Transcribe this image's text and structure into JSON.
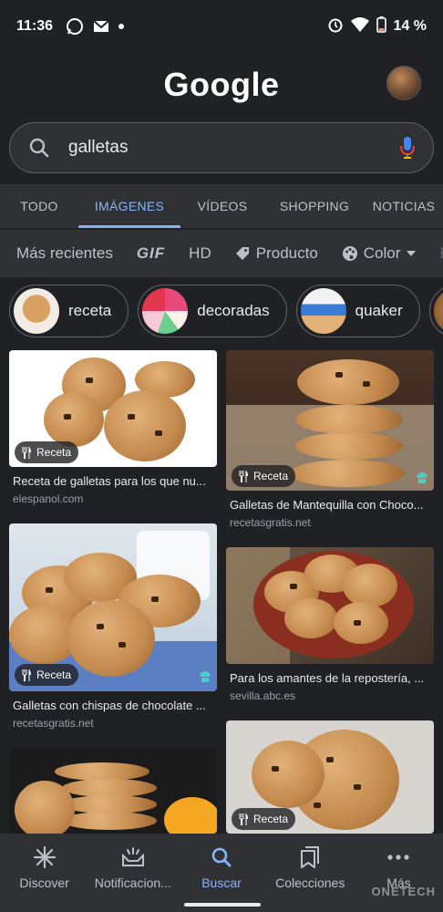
{
  "status_bar": {
    "time": "11:36",
    "battery": "14 %",
    "icons": [
      "whatsapp-icon",
      "gmail-icon",
      "dot-icon",
      "alarm-icon",
      "wifi-icon",
      "battery-icon"
    ]
  },
  "header": {
    "logo": "Google"
  },
  "search": {
    "query": "galletas"
  },
  "tabs": [
    {
      "label": "TODO",
      "active": false
    },
    {
      "label": "IMÁGENES",
      "active": true
    },
    {
      "label": "VÍDEOS",
      "active": false
    },
    {
      "label": "SHOPPING",
      "active": false
    },
    {
      "label": "NOTICIAS",
      "active": false
    }
  ],
  "filters": [
    "Más recientes",
    "GIF",
    "HD",
    "Producto",
    "Color",
    "E"
  ],
  "chips": [
    {
      "label": "receta"
    },
    {
      "label": "decoradas"
    },
    {
      "label": "quaker"
    }
  ],
  "results": [
    {
      "caption": "Receta de galletas para los que nu...",
      "source": "elespanol.com",
      "badge": "Receta"
    },
    {
      "caption": "Galletas de Mantequilla con Choco...",
      "source": "recetasgratis.net",
      "badge": "Receta"
    },
    {
      "caption": "Galletas con chispas de chocolate ...",
      "source": "recetasgratis.net",
      "badge": "Receta"
    },
    {
      "caption": "Para los amantes de la repostería, ...",
      "source": "sevilla.abc.es",
      "badge": ""
    },
    {
      "caption": "",
      "source": "",
      "badge": ""
    },
    {
      "caption": "",
      "source": "",
      "badge": "Receta"
    }
  ],
  "bottom_nav": [
    {
      "label": "Discover",
      "icon": "discover-icon",
      "active": false
    },
    {
      "label": "Notificacion...",
      "icon": "notifications-icon",
      "active": false
    },
    {
      "label": "Buscar",
      "icon": "search-icon",
      "active": true
    },
    {
      "label": "Colecciones",
      "icon": "collections-icon",
      "active": false
    },
    {
      "label": "Más",
      "icon": "more-icon",
      "active": false
    }
  ],
  "watermark": "ONETECH",
  "colors": {
    "background": "#202124",
    "surface": "#303134",
    "accent": "#8ab4f8"
  }
}
